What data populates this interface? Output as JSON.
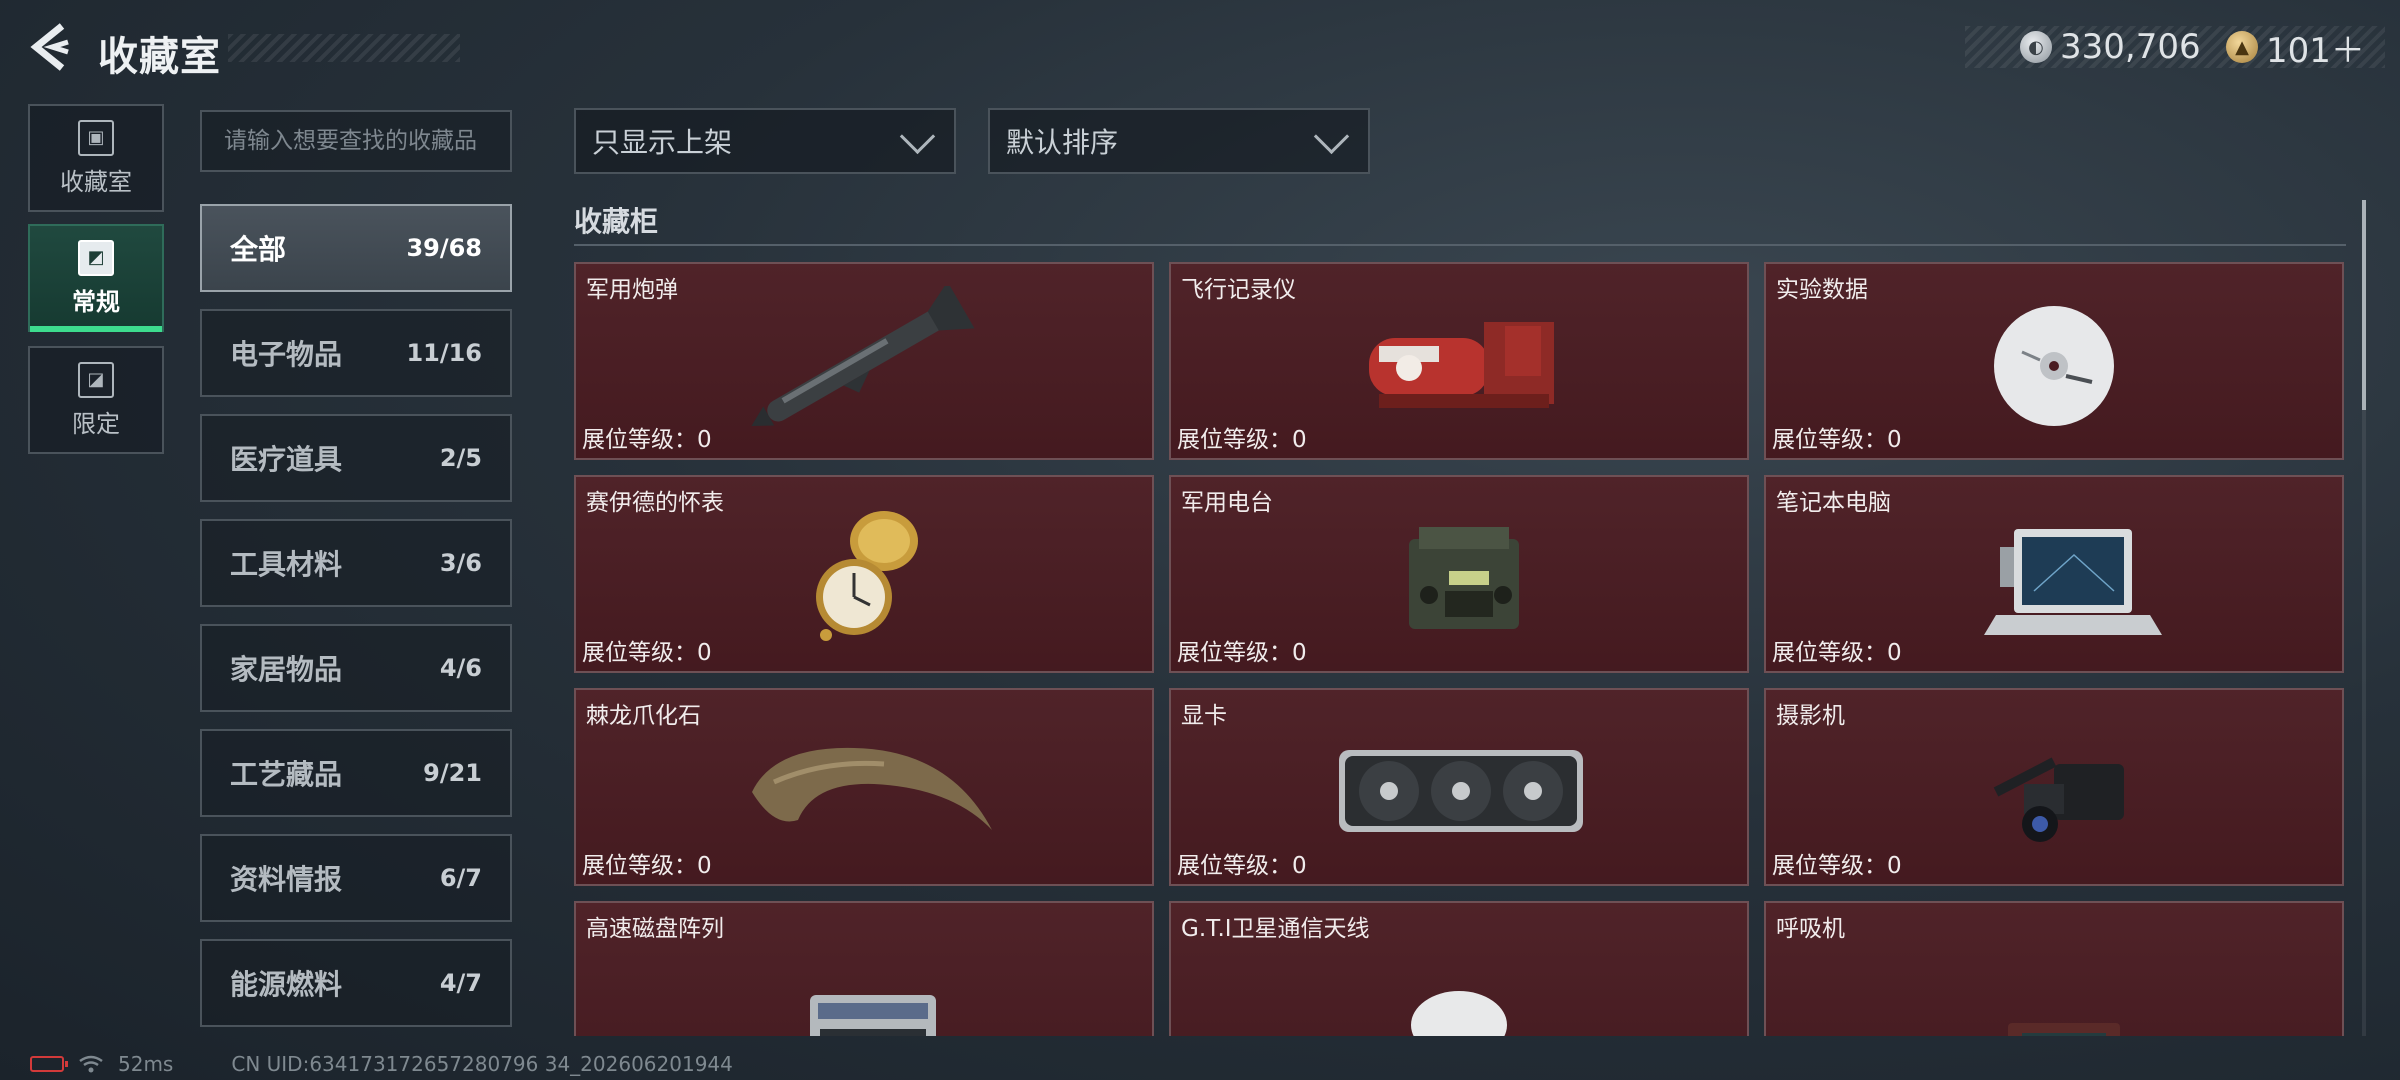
{
  "header": {
    "title": "收藏室",
    "currency_silver": "330,706",
    "currency_gold": "101＋"
  },
  "modes": [
    {
      "label": "收藏室",
      "icon": "trash-bin-icon",
      "active": false
    },
    {
      "label": "常规",
      "icon": "picture-frame-icon",
      "active": true
    },
    {
      "label": "限定",
      "icon": "limited-frame-icon",
      "active": false
    }
  ],
  "search": {
    "placeholder": "请输入想要查找的收藏品",
    "value": ""
  },
  "categories": [
    {
      "name": "全部",
      "count": "39/68",
      "active": true
    },
    {
      "name": "电子物品",
      "count": "11/16"
    },
    {
      "name": "医疗道具",
      "count": "2/5"
    },
    {
      "name": "工具材料",
      "count": "3/6"
    },
    {
      "name": "家居物品",
      "count": "4/6"
    },
    {
      "name": "工艺藏品",
      "count": "9/21"
    },
    {
      "name": "资料情报",
      "count": "6/7"
    },
    {
      "name": "能源燃料",
      "count": "4/7"
    }
  ],
  "filters": {
    "show_filter": "只显示上架",
    "sort": "默认排序"
  },
  "section": {
    "title": "收藏柜"
  },
  "items": [
    {
      "name": "军用炮弹",
      "level": "展位等级：0",
      "icon": "missile-icon"
    },
    {
      "name": "飞行记录仪",
      "level": "展位等级：0",
      "icon": "flight-recorder-icon"
    },
    {
      "name": "实验数据",
      "level": "展位等级：0",
      "icon": "disc-icon"
    },
    {
      "name": "赛伊德的怀表",
      "level": "展位等级：0",
      "icon": "pocket-watch-icon"
    },
    {
      "name": "军用电台",
      "level": "展位等级：0",
      "icon": "radio-icon"
    },
    {
      "name": "笔记本电脑",
      "level": "展位等级：0",
      "icon": "laptop-icon"
    },
    {
      "name": "棘龙爪化石",
      "level": "展位等级：0",
      "icon": "claw-fossil-icon"
    },
    {
      "name": "显卡",
      "level": "展位等级：0",
      "icon": "graphics-card-icon"
    },
    {
      "name": "摄影机",
      "level": "展位等级：0",
      "icon": "video-camera-icon"
    },
    {
      "name": "高速磁盘阵列",
      "level": "",
      "icon": "disk-array-icon"
    },
    {
      "name": "G.T.I卫星通信天线",
      "level": "",
      "icon": "satellite-dish-icon"
    },
    {
      "name": "呼吸机",
      "level": "",
      "icon": "ventilator-icon"
    }
  ],
  "footer": {
    "ping": "52ms",
    "uid": "CN UID:634173172657280796 34_202606201944"
  }
}
